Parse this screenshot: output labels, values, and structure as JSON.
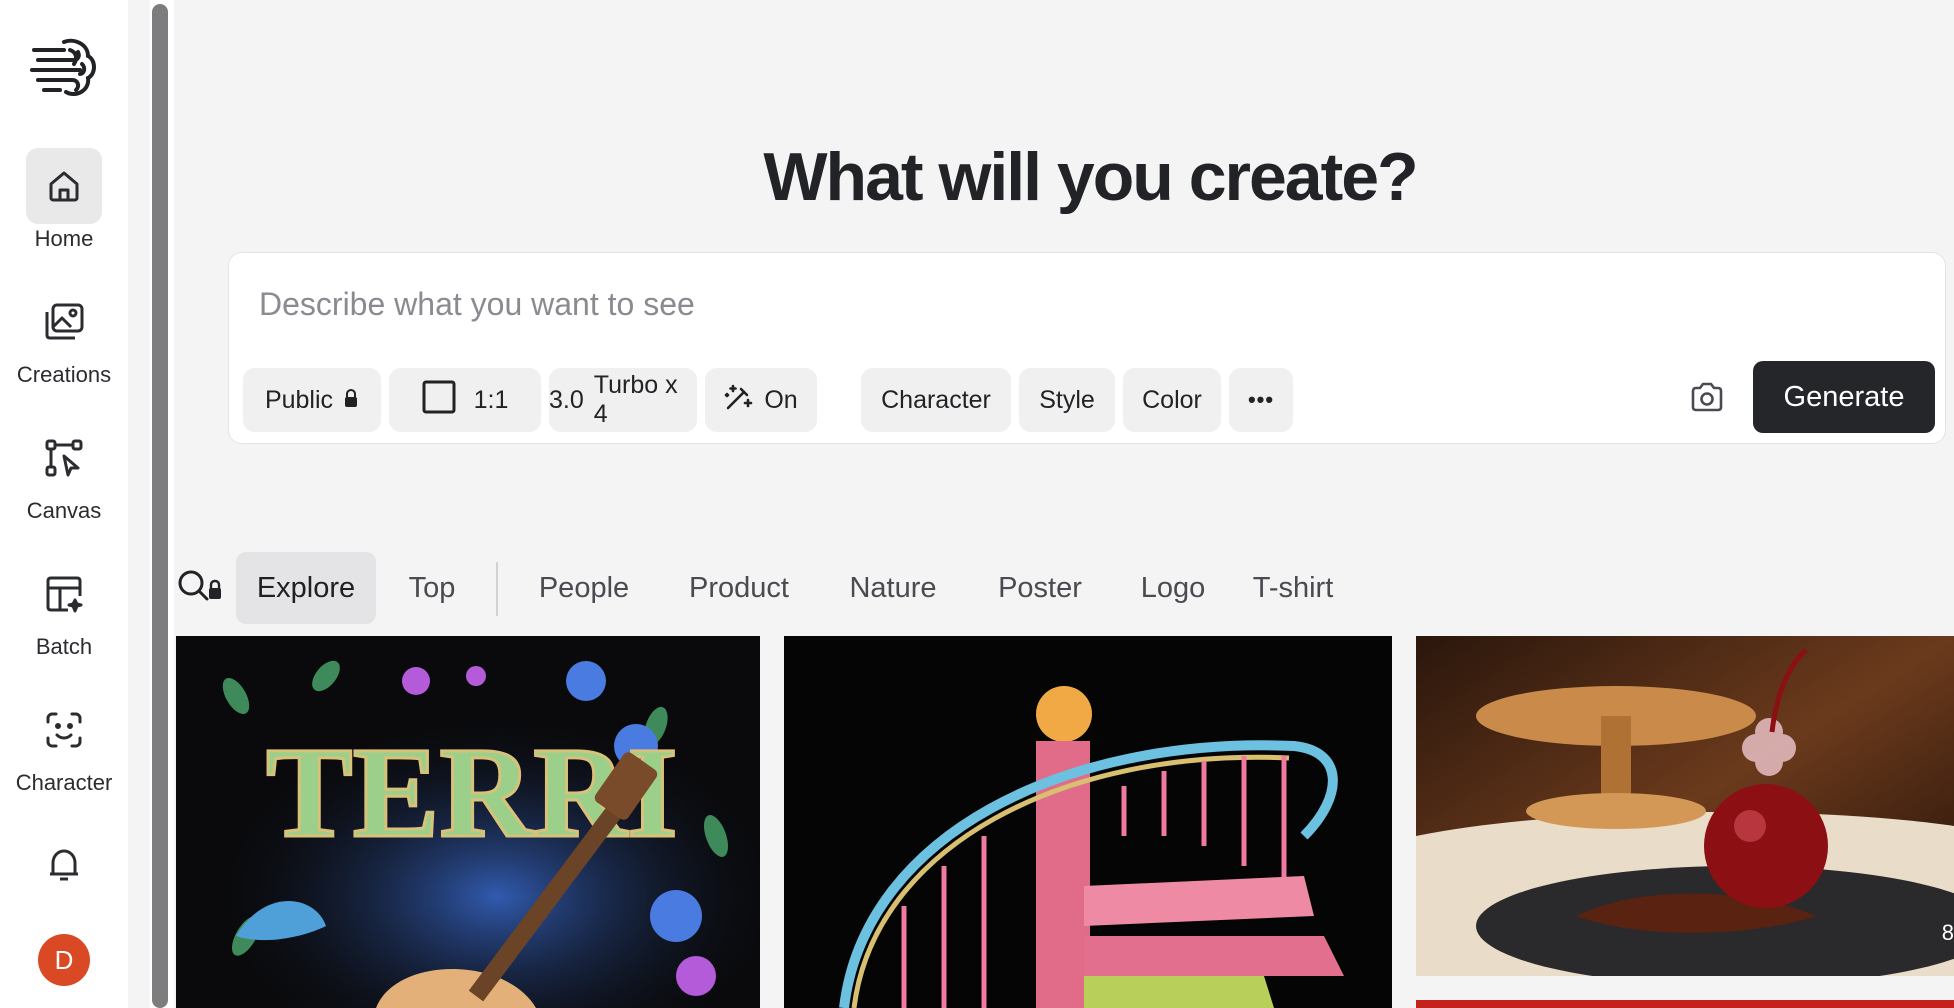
{
  "sidebar": {
    "items": [
      {
        "label": "Home",
        "icon": "home-icon"
      },
      {
        "label": "Creations",
        "icon": "gallery-icon"
      },
      {
        "label": "Canvas",
        "icon": "canvas-icon"
      },
      {
        "label": "Batch",
        "icon": "batch-icon"
      },
      {
        "label": "Character",
        "icon": "face-scan-icon"
      }
    ],
    "notifications_icon": "bell-icon",
    "avatar_initial": "D"
  },
  "hero": {
    "title": "What will you create?"
  },
  "prompt": {
    "placeholder": "Describe what you want to see",
    "chips": {
      "visibility": "Public",
      "aspect": "1:1",
      "model_version": "3.0",
      "model_name": "Turbo x 4",
      "magic": "On",
      "character": "Character",
      "style": "Style",
      "color": "Color",
      "more": "•••"
    },
    "generate_label": "Generate"
  },
  "tabs": {
    "items": [
      "Explore",
      "Top",
      "People",
      "Product",
      "Nature",
      "Poster",
      "Logo",
      "T-shirt"
    ],
    "active": "Explore"
  },
  "gallery": {
    "cards": [
      {
        "title_text": "TERRI",
        "theme": "guitar-roses-hummingbird"
      },
      {
        "theme": "spiral-staircase"
      },
      {
        "theme": "cherry-dessert",
        "count": "8"
      }
    ]
  },
  "colors": {
    "generate_bg": "#25262a",
    "avatar_bg": "#d94a24",
    "active_tab_bg": "#e4e4e6"
  }
}
